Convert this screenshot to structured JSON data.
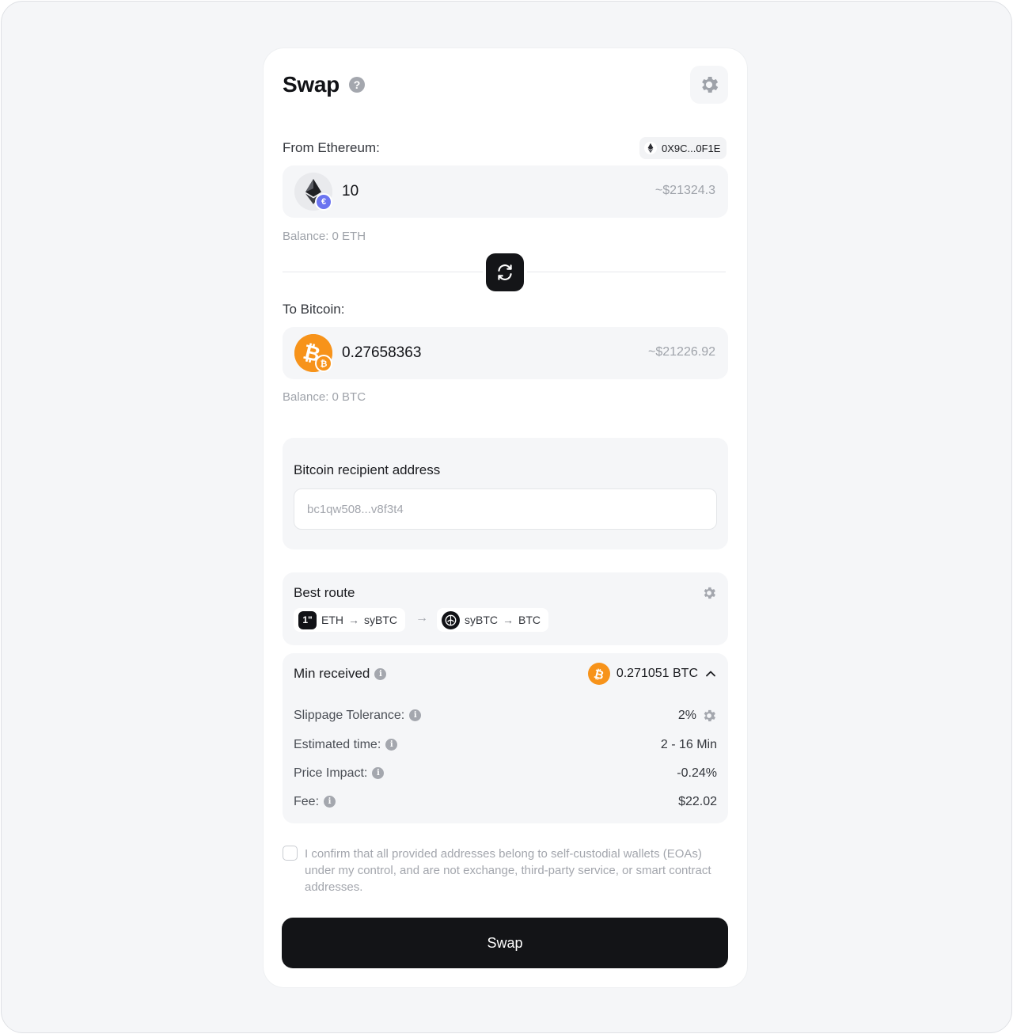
{
  "header": {
    "title": "Swap",
    "help_glyph": "?"
  },
  "from": {
    "label": "From Ethereum:",
    "wallet": "0X9C...0F1E",
    "amount": "10",
    "usd": "~$21324.3",
    "balance": "Balance: 0 ETH"
  },
  "to": {
    "label": "To Bitcoin:",
    "amount": "0.27658363",
    "usd": "~$21226.92",
    "balance": "Balance: 0 BTC"
  },
  "recipient": {
    "label": "Bitcoin recipient address",
    "placeholder": "bc1qw508...v8f3t4"
  },
  "route": {
    "label": "Best route",
    "steps": [
      {
        "provider_glyph": "1\"",
        "from": "ETH",
        "arrow": "→",
        "to": "syBTC"
      },
      {
        "from": "syBTC",
        "arrow": "→",
        "to": "BTC"
      }
    ],
    "between_arrow": "→"
  },
  "details": {
    "min_received_label": "Min received",
    "min_received_value": "0.271051 BTC",
    "rows": [
      {
        "label": "Slippage Tolerance:",
        "value": "2%"
      },
      {
        "label": "Estimated time:",
        "value": "2 - 16 Min"
      },
      {
        "label": "Price Impact:",
        "value": "-0.24%"
      },
      {
        "label": "Fee:",
        "value": "$22.02"
      }
    ],
    "info_glyph": "i"
  },
  "confirm": {
    "text": "I confirm that all provided addresses belong to self-custodial wallets (EOAs) under my control, and are not exchange, third-party service, or smart contract addresses.",
    "checked": false
  },
  "action": {
    "swap_label": "Swap"
  },
  "icons": {
    "settings": "gear-icon",
    "swap_direction": "swap-arrows-icon",
    "eth": "ethereum-icon",
    "btc": "bitcoin-icon",
    "chevron": "chevron-up-icon"
  },
  "colors": {
    "btc_orange": "#f7931a",
    "primary_dark": "#131417",
    "eth_badge": "#6b74f0",
    "muted_text": "#9fa3aa"
  }
}
